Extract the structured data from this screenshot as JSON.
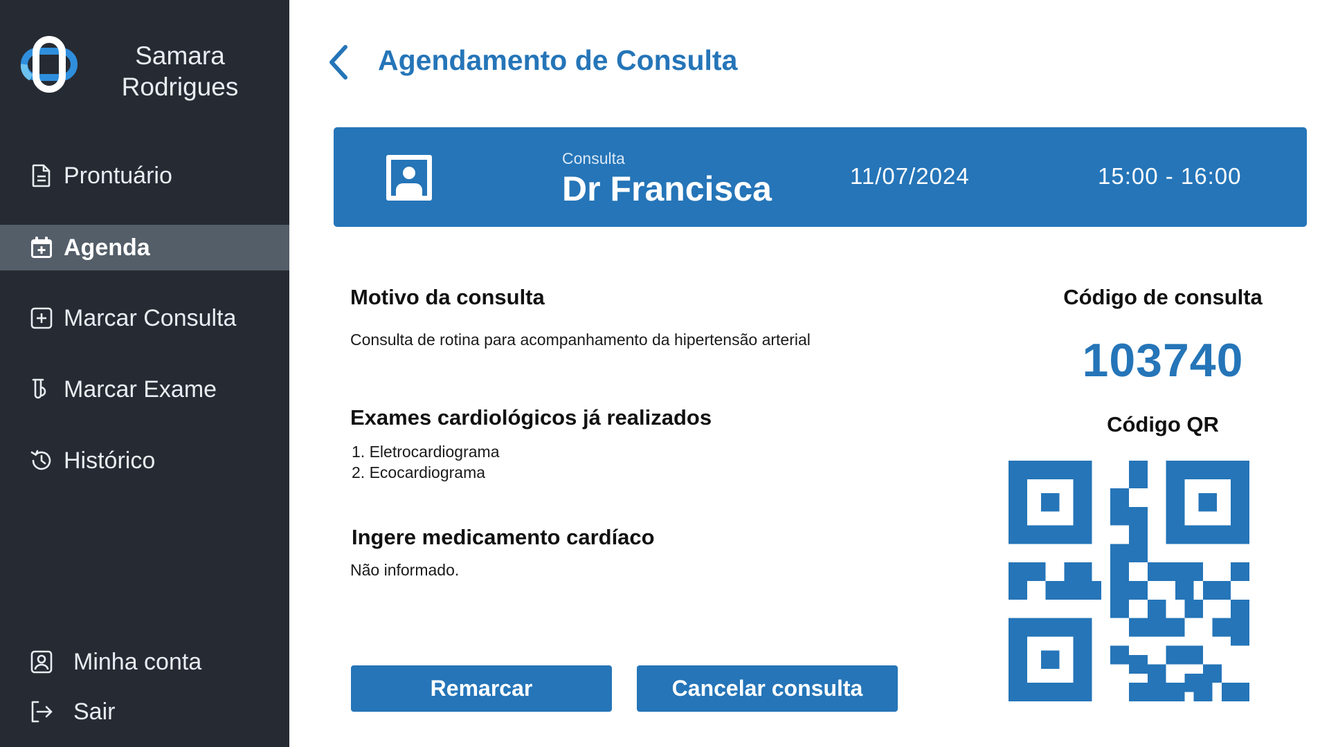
{
  "sidebar": {
    "user": {
      "line1": "Samara",
      "line2": "Rodrigues"
    },
    "items": [
      {
        "label": "Prontuário",
        "icon": "document-icon"
      },
      {
        "label": "Agenda",
        "icon": "calendar-icon",
        "active": true
      },
      {
        "label": "Marcar Consulta",
        "icon": "plus-square-icon"
      },
      {
        "label": "Marcar Exame",
        "icon": "test-tube-icon"
      },
      {
        "label": "Histórico",
        "icon": "history-icon"
      }
    ],
    "bottom": [
      {
        "label": "Minha conta",
        "icon": "user-badge-icon"
      },
      {
        "label": "Sair",
        "icon": "logout-icon"
      }
    ]
  },
  "header": {
    "title": "Agendamento de Consulta"
  },
  "appointment": {
    "kicker": "Consulta",
    "doctor": "Dr Francisca",
    "date": "11/07/2024",
    "time": "15:00 - 16:00"
  },
  "details": {
    "reason_title": "Motivo da consulta",
    "reason_text": "Consulta de rotina para acompanhamento da hipertensão arterial",
    "exams_title": "Exames cardiológicos já realizados",
    "exams": [
      "1. Eletrocardiograma",
      "2. Ecocardiograma"
    ],
    "medication_title": "Ingere medicamento cardíaco",
    "medication_text": "Não informado."
  },
  "actions": {
    "reschedule": "Remarcar",
    "cancel": "Cancelar consulta"
  },
  "code": {
    "title": "Código de consulta",
    "value": "103740",
    "qr_title": "Código QR"
  },
  "colors": {
    "accent": "#2575b8",
    "sidebar": "#262b33",
    "active_item": "#545e69",
    "logo_light": "#6cc2ef"
  }
}
